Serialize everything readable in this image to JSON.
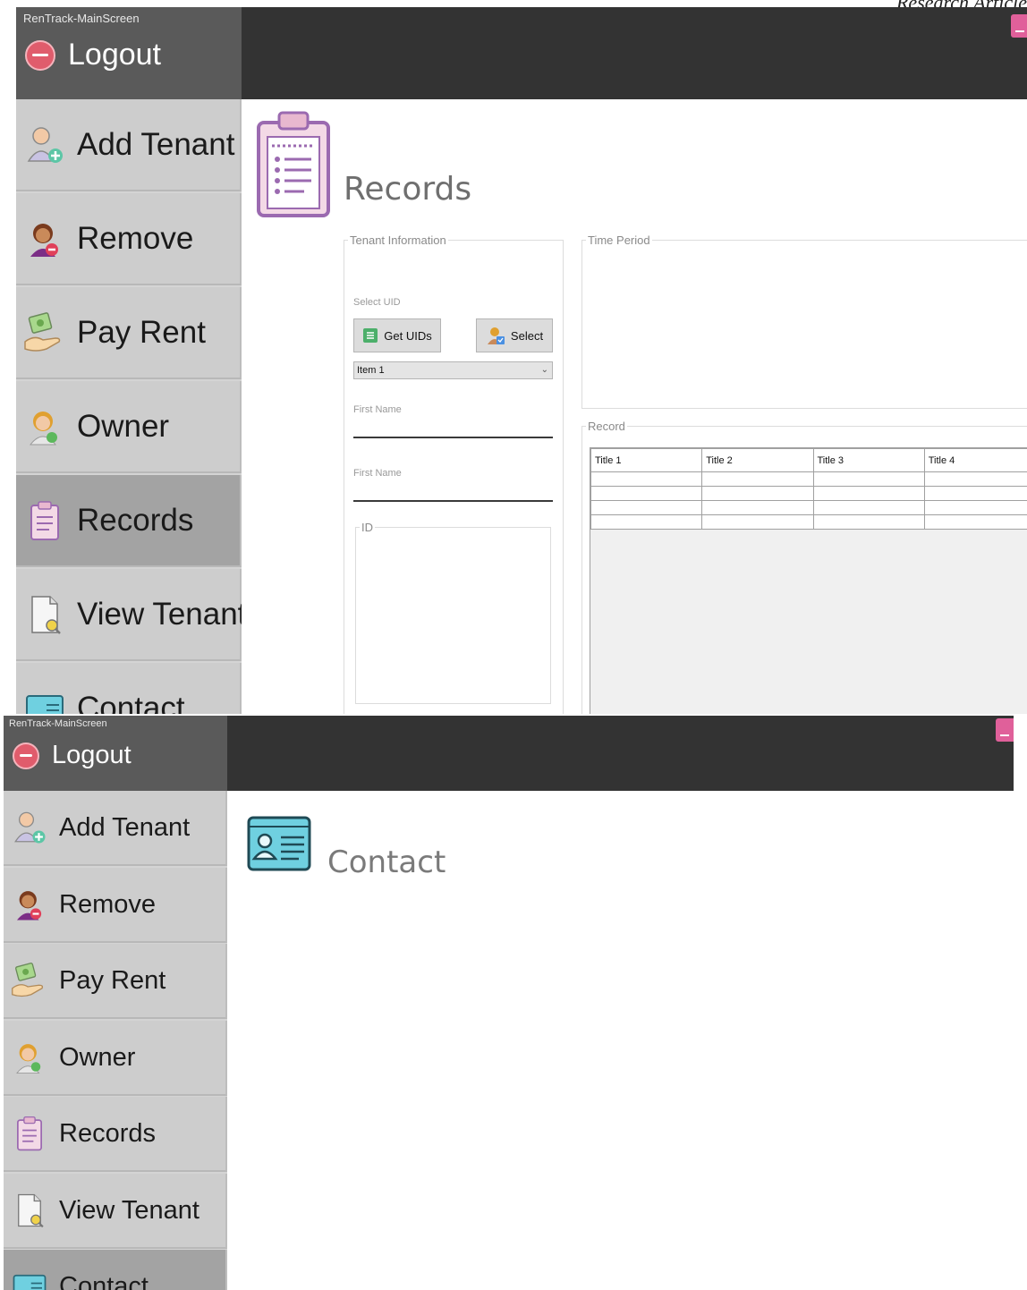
{
  "page_header": "Research Article",
  "screen1": {
    "app_title": "RenTrack-MainScreen",
    "logout_label": "Logout",
    "nav_items": [
      {
        "label": "Add Tenant"
      },
      {
        "label": "Remove"
      },
      {
        "label": "Pay Rent"
      },
      {
        "label": "Owner"
      },
      {
        "label": "Records",
        "active": true
      },
      {
        "label": "View Tenant"
      },
      {
        "label": "Contact"
      }
    ],
    "page_title": "Records",
    "tenant_info": {
      "legend": "Tenant Information",
      "select_uid_label": "Select UID",
      "get_uids_button": "Get UIDs",
      "select_button": "Select",
      "uid_combo_value": "Item 1",
      "first_name_label_1": "First Name",
      "first_name_label_2": "First Name",
      "id_legend": "ID"
    },
    "time_period_legend": "Time Period",
    "record": {
      "legend": "Record",
      "columns": [
        "Title 1",
        "Title 2",
        "Title 3",
        "Title 4"
      ]
    }
  },
  "screen2": {
    "app_title": "RenTrack-MainScreen",
    "logout_label": "Logout",
    "nav_items": [
      {
        "label": "Add Tenant"
      },
      {
        "label": "Remove"
      },
      {
        "label": "Pay Rent"
      },
      {
        "label": "Owner"
      },
      {
        "label": "Records"
      },
      {
        "label": "View Tenant"
      },
      {
        "label": "Contact",
        "active": true
      }
    ],
    "page_title": "Contact"
  },
  "colors": {
    "topbar": "#333333",
    "sidebar": "#cdcdcd",
    "active_nav": "#a3a3a3",
    "minimize_button": "#e0609a",
    "logout_icon": "#e05c6c"
  }
}
